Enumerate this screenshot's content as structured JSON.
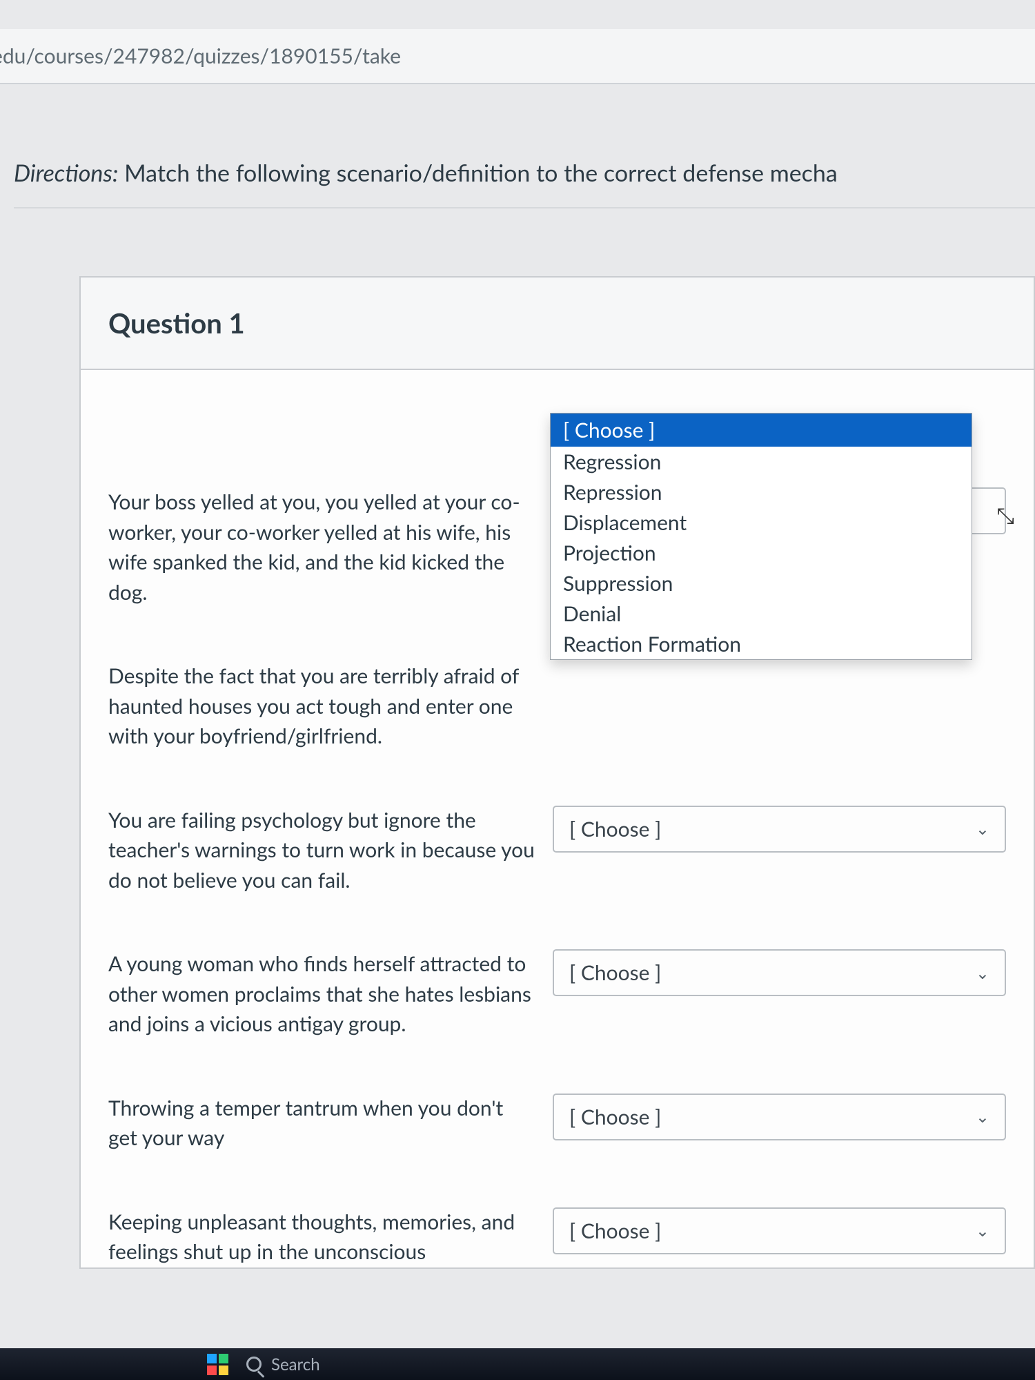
{
  "address_bar": "edu/courses/247982/quizzes/1890155/take",
  "directions_label": "Directions:",
  "directions_text": " Match the following scenario/definition to the correct defense mecha",
  "question_title": "Question 1",
  "choose_placeholder": "[ Choose ]",
  "rows": [
    {
      "prompt": "Your boss yelled at you, you yelled at your co-worker, your co-worker yelled at his wife, his wife spanked the kid, and the kid kicked the dog."
    },
    {
      "prompt": "Despite the fact that you are terribly afraid of haunted houses you act tough and enter one with your boyfriend/girlfriend."
    },
    {
      "prompt": "You are failing psychology but ignore the teacher's warnings to turn work in because you do not believe you can fail."
    },
    {
      "prompt": "A young woman who finds herself attracted to other women proclaims that she hates lesbians and joins a vicious antigay group."
    },
    {
      "prompt": "Throwing a temper tantrum when you don't get your way"
    },
    {
      "prompt": "Keeping unpleasant thoughts, memories, and feelings shut up in the unconscious"
    }
  ],
  "dropdown": {
    "selected": "[ Choose ]",
    "options": [
      "Regression",
      "Repression",
      "Displacement",
      "Projection",
      "Suppression",
      "Denial",
      "Reaction Formation"
    ]
  },
  "taskbar_search": "Search"
}
